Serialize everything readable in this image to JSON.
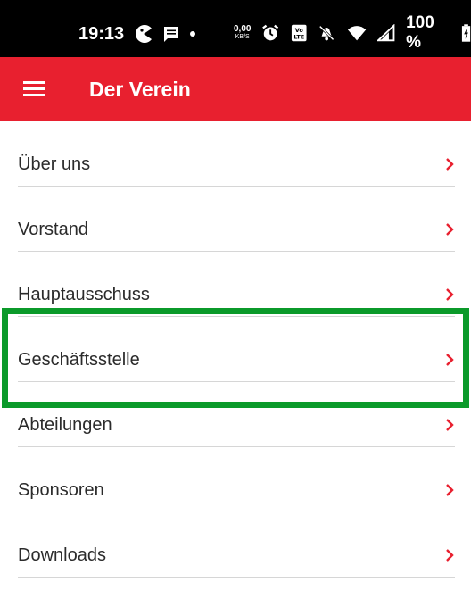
{
  "status_bar": {
    "time": "19:13",
    "net_speed_value": "0,00",
    "net_speed_unit": "KB/S",
    "battery_percent": "100 %",
    "icons": [
      "pacman-icon",
      "message-icon",
      "dot-icon",
      "alarm-icon",
      "volte-icon",
      "mute-icon",
      "wifi-icon",
      "signal-icon",
      "battery-charging-icon"
    ]
  },
  "app_bar": {
    "title": "Der Verein",
    "menu_icon": "hamburger-menu-icon"
  },
  "menu": {
    "items": [
      {
        "label": "Über uns"
      },
      {
        "label": "Vorstand"
      },
      {
        "label": "Hauptausschuss"
      },
      {
        "label": "Geschäftsstelle"
      },
      {
        "label": "Abteilungen"
      },
      {
        "label": "Sponsoren"
      },
      {
        "label": "Downloads"
      }
    ],
    "chevron_icon": "chevron-right-icon"
  },
  "colors": {
    "app_bar": "#e8202f",
    "chevron": "#e8202f",
    "highlight": "#0b9a2a",
    "status_bar": "#000000"
  }
}
